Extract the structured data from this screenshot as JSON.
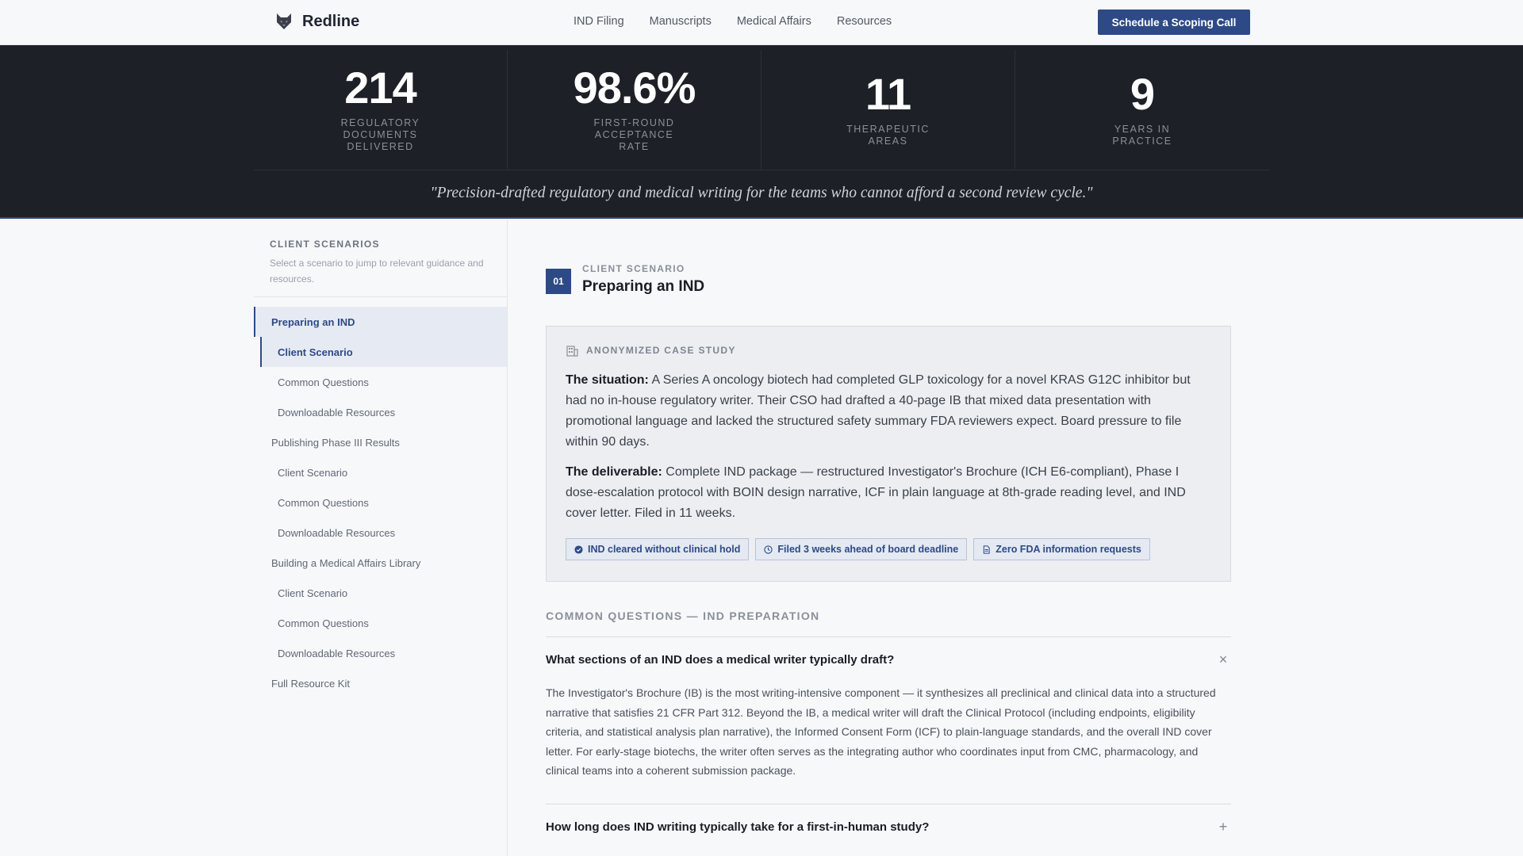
{
  "nav": {
    "brand": "Redline",
    "links": [
      "IND Filing",
      "Manuscripts",
      "Medical Affairs",
      "Resources"
    ],
    "cta": "Schedule a Scoping Call"
  },
  "stats": [
    {
      "value": "214",
      "label": "Regulatory Documents Delivered"
    },
    {
      "value": "98.6%",
      "label": "First-Round Acceptance Rate"
    },
    {
      "value": "11",
      "label": "Therapeutic Areas"
    },
    {
      "value": "9",
      "label": "Years in Practice"
    }
  ],
  "tagline": "\"Precision-drafted regulatory and medical writing for the teams who cannot afford a second review cycle.\"",
  "sidebar": {
    "title": "Client Scenarios",
    "description": "Select a scenario to jump to relevant guidance and resources.",
    "items": [
      {
        "label": "Preparing an IND",
        "level": "parent",
        "state": "active"
      },
      {
        "label": "Client Scenario",
        "level": "child",
        "state": "active"
      },
      {
        "label": "Common Questions",
        "level": "child"
      },
      {
        "label": "Downloadable Resources",
        "level": "child"
      },
      {
        "label": "Publishing Phase III Results",
        "level": "parent"
      },
      {
        "label": "Client Scenario",
        "level": "child"
      },
      {
        "label": "Common Questions",
        "level": "child"
      },
      {
        "label": "Downloadable Resources",
        "level": "child"
      },
      {
        "label": "Building a Medical Affairs Library",
        "level": "parent"
      },
      {
        "label": "Client Scenario",
        "level": "child"
      },
      {
        "label": "Common Questions",
        "level": "child"
      },
      {
        "label": "Downloadable Resources",
        "level": "child"
      },
      {
        "label": "Full Resource Kit",
        "level": "parent"
      }
    ]
  },
  "scenario": {
    "number": "01",
    "eyebrow": "Client Scenario",
    "title": "Preparing an IND",
    "case": {
      "heading": "Anonymized Case Study",
      "situation_label": "The situation:",
      "situation": " A Series A oncology biotech had completed GLP toxicology for a novel KRAS G12C inhibitor but had no in-house regulatory writer. Their CSO had drafted a 40-page IB that mixed data presentation with promotional language and lacked the structured safety summary FDA reviewers expect. Board pressure to file within 90 days.",
      "deliverable_label": "The deliverable:",
      "deliverable": " Complete IND package — restructured Investigator's Brochure (ICH E6-compliant), Phase I dose-escalation protocol with BOIN design narrative, ICF in plain language at 8th-grade reading level, and IND cover letter. Filed in 11 weeks.",
      "chips": [
        {
          "icon": "check-circle-icon",
          "label": "IND cleared without clinical hold"
        },
        {
          "icon": "clock-icon",
          "label": "Filed 3 weeks ahead of board deadline"
        },
        {
          "icon": "document-icon",
          "label": "Zero FDA information requests"
        }
      ]
    },
    "faq": {
      "title": "Common Questions — IND Preparation",
      "items": [
        {
          "question": "What sections of an IND does a medical writer typically draft?",
          "toggle": "×",
          "expanded": true,
          "answer": "The Investigator's Brochure (IB) is the most writing-intensive component — it synthesizes all preclinical and clinical data into a structured narrative that satisfies 21 CFR Part 312. Beyond the IB, a medical writer will draft the Clinical Protocol (including endpoints, eligibility criteria, and statistical analysis plan narrative), the Informed Consent Form (ICF) to plain-language standards, and the overall IND cover letter. For early-stage biotechs, the writer often serves as the integrating author who coordinates input from CMC, pharmacology, and clinical teams into a coherent submission package."
        },
        {
          "question": "How long does IND writing typically take for a first-in-human study?",
          "toggle": "+",
          "expanded": false
        }
      ]
    }
  },
  "colors": {
    "accent": "#2d4a87",
    "band": "#1d2026",
    "page": "#f7f8fa"
  }
}
